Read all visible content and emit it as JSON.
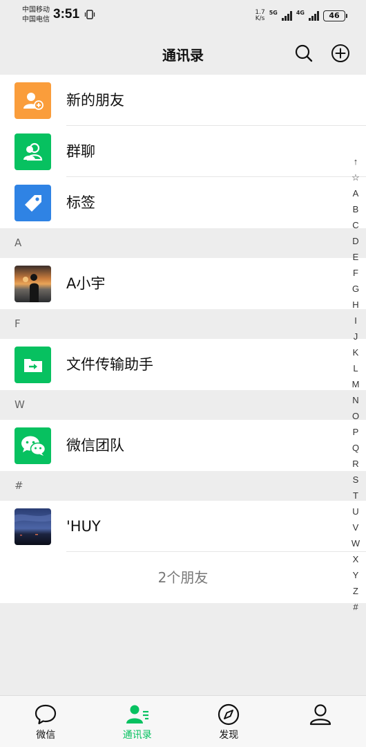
{
  "status_bar": {
    "carrier_1": "中国移动",
    "carrier_2": "中国电信",
    "time": "3:51",
    "speed_value": "1.7",
    "speed_unit": "K/s",
    "net_1": "5G",
    "net_2": "4G",
    "battery": "46"
  },
  "header": {
    "title": "通讯录",
    "search_icon": "search-icon",
    "add_icon": "plus-circle-icon"
  },
  "top_items": [
    {
      "label": "新的朋友",
      "icon": "add-friend-icon",
      "color": "#fa9d3b"
    },
    {
      "label": "群聊",
      "icon": "group-icon",
      "color": "#07c160"
    },
    {
      "label": "标签",
      "icon": "tag-icon",
      "color": "#2f83e4"
    }
  ],
  "sections": [
    {
      "letter": "A",
      "contacts": [
        {
          "name": "A小宇",
          "avatar": "sunset-photo"
        }
      ]
    },
    {
      "letter": "F",
      "contacts": [
        {
          "name": "文件传输助手",
          "avatar": "file-transfer-icon"
        }
      ]
    },
    {
      "letter": "W",
      "contacts": [
        {
          "name": "微信团队",
          "avatar": "wechat-icon"
        }
      ]
    },
    {
      "letter": "#",
      "contacts": [
        {
          "name": "'HUY",
          "avatar": "night-sky-photo"
        }
      ]
    }
  ],
  "friend_count": "2个朋友",
  "index_letters": [
    "↑",
    "☆",
    "A",
    "B",
    "C",
    "D",
    "E",
    "F",
    "G",
    "H",
    "I",
    "J",
    "K",
    "L",
    "M",
    "N",
    "O",
    "P",
    "Q",
    "R",
    "S",
    "T",
    "U",
    "V",
    "W",
    "X",
    "Y",
    "Z",
    "#"
  ],
  "tabs": [
    {
      "label": "微信",
      "icon": "chat-bubble-icon",
      "active": false
    },
    {
      "label": "通讯录",
      "icon": "contacts-icon",
      "active": true
    },
    {
      "label": "发现",
      "icon": "compass-icon",
      "active": false
    },
    {
      "label": "我",
      "icon": "person-icon",
      "active": false
    }
  ],
  "colors": {
    "accent": "#07c160",
    "background": "#ededed",
    "orange": "#fa9d3b",
    "blue": "#2f83e4"
  }
}
